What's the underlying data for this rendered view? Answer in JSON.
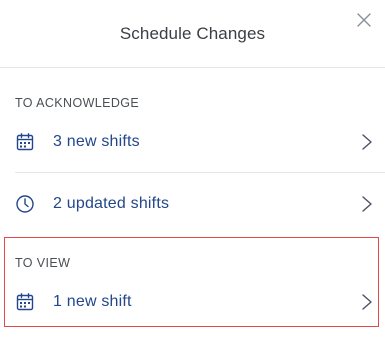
{
  "dialog": {
    "title": "Schedule Changes",
    "close_icon": "close-icon"
  },
  "sections": {
    "acknowledge": {
      "label": "TO ACKNOWLEDGE",
      "items": [
        {
          "label": "3 new shifts",
          "icon": "calendar-icon"
        },
        {
          "label": "2 updated shifts",
          "icon": "clock-icon"
        }
      ]
    },
    "view": {
      "label": "TO VIEW",
      "items": [
        {
          "label": "1 new shift",
          "icon": "calendar-icon"
        }
      ]
    }
  },
  "colors": {
    "accent": "#23478a",
    "highlight_border": "#e24a4a",
    "divider": "#e3e6ea"
  }
}
